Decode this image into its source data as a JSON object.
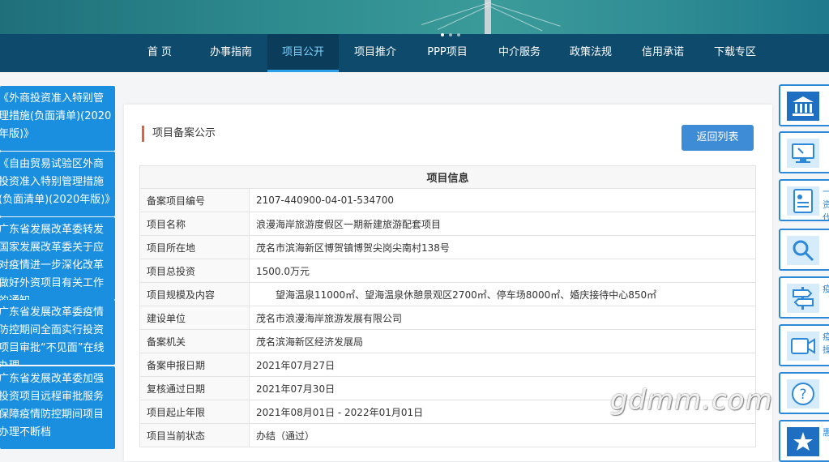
{
  "nav": {
    "items": [
      {
        "label": "首 页"
      },
      {
        "label": "办事指南"
      },
      {
        "label": "项目公开"
      },
      {
        "label": "项目推介"
      },
      {
        "label": "PPP项目"
      },
      {
        "label": "中介服务"
      },
      {
        "label": "政策法规"
      },
      {
        "label": "信用承诺"
      },
      {
        "label": "下载专区"
      }
    ],
    "active_index": 2
  },
  "news": [
    {
      "text": "《外商投资准入特别管理措施(负面清单)(2020年版)》"
    },
    {
      "text": "《自由贸易试验区外商投资准入特别管理措施(负面清单)(2020年版)》"
    },
    {
      "text": "广东省发展改革委转发国家发展改革委关于应对疫情进一步深化改革做好外资项目有关工作的通知"
    },
    {
      "text": "广东省发展改革委疫情防控期间全面实行投资项目审批“不见面”在线办理"
    },
    {
      "text": "广东省发展改革委加强投资项目远程审批服务保障疫情防控期间项目办理不断档"
    }
  ],
  "panel": {
    "title": "项目备案公示",
    "back_label": "返回列表",
    "table_header": "项目信息",
    "rows": [
      {
        "label": "备案项目编号",
        "value": "2107-440900-04-01-534700"
      },
      {
        "label": "项目名称",
        "value": "浪漫海岸旅游度假区一期新建旅游配套项目"
      },
      {
        "label": "项目所在地",
        "value": "茂名市滨海新区博贺镇博贺尖岗尖南村138号"
      },
      {
        "label": "项目总投资",
        "value": "1500.0万元"
      },
      {
        "label": "项目规模及内容",
        "value": "　　望海温泉11000㎡、望海温泉休憩景观区2700㎡、停车场8000㎡、婚庆接待中心850㎡"
      },
      {
        "label": "建设单位",
        "value": "茂名市浪漫海岸旅游发展有限公司"
      },
      {
        "label": "备案机关",
        "value": "茂名滨海新区经济发展局"
      },
      {
        "label": "备案申报日期",
        "value": "2021年07月27日"
      },
      {
        "label": "复核通过日期",
        "value": "2021年07月30日"
      },
      {
        "label": "项目起止年限",
        "value": "2021年08月01日 - 2022年01月01日"
      },
      {
        "label": "项目当前状态",
        "value": "办结（通过）"
      }
    ]
  },
  "side": [
    {
      "icon": "bank-icon",
      "text": ""
    },
    {
      "icon": "monitor-icon",
      "text": ""
    },
    {
      "icon": "id-card-icon",
      "text": "一资代"
    },
    {
      "icon": "magnifier-icon",
      "text": ""
    },
    {
      "icon": "signpost-icon",
      "text": "疫"
    },
    {
      "icon": "video-camera-icon",
      "text": "疫操"
    },
    {
      "icon": "question-icon",
      "text": ""
    },
    {
      "icon": "star-badge-icon",
      "text": "惠"
    }
  ],
  "watermark": "gdmm.com",
  "colors": {
    "nav_bg": "#0e4a6c",
    "nav_active": "#2aa0e8",
    "news_bg": "#1a8fe0",
    "button_bg": "#3e8bd6",
    "accent": "#e3603d"
  }
}
